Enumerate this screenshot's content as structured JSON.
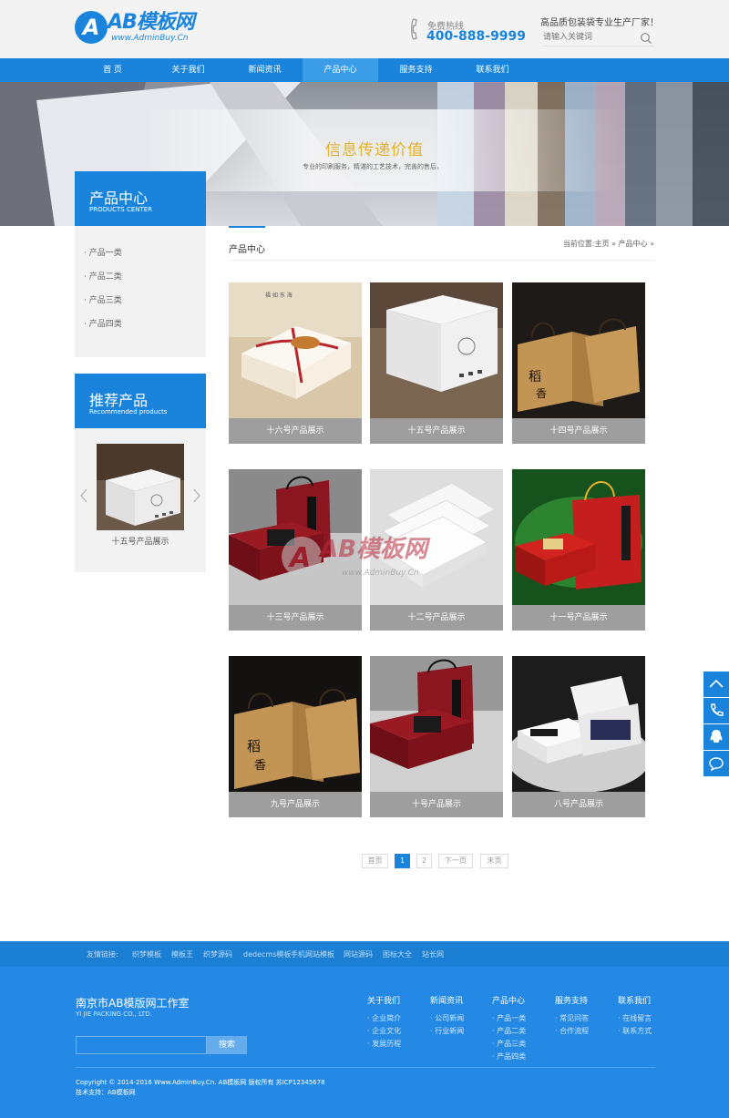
{
  "header": {
    "logo": {
      "mark": "A",
      "name": "AB模板网",
      "url": "www.AdminBuy.Cn"
    },
    "hotline_label": "免费热线",
    "hotline_number": "400-888-9999",
    "slogan": "高品质包装袋专业生产厂家！",
    "search_placeholder": "请输入关键词"
  },
  "nav": [
    "首 页",
    "关于我们",
    "新闻资讯",
    "产品中心",
    "服务支持",
    "联系我们"
  ],
  "nav_active": "产品中心",
  "banner": {
    "title": "信息传递价值",
    "subtitle": "专业的印刷服务，精湛的工艺技术，完善的售后，"
  },
  "sidebar": {
    "category_title": "产品中心",
    "category_title_en": "PRODUCTS CENTER",
    "categories": [
      "产品一类",
      "产品二类",
      "产品三类",
      "产品四类"
    ],
    "recommend_title": "推荐产品",
    "recommend_title_en": "Recommended products",
    "recommend_caption": "十五号产品展示"
  },
  "content": {
    "section_title": "产品中心",
    "breadcrumb": "当前位置:主页 » 产品中心 »",
    "products": [
      "十六号产品展示",
      "十五号产品展示",
      "十四号产品展示",
      "十三号产品展示",
      "十二号产品展示",
      "十一号产品展示",
      "九号产品展示",
      "十号产品展示",
      "八号产品展示"
    ],
    "watermark": {
      "name": "AB模板网",
      "url": "www.AdminBuy.Cn"
    }
  },
  "pager": [
    "首页",
    "1",
    "2",
    "下一页",
    "末页"
  ],
  "pager_current": "1",
  "footer": {
    "links_label": "友情链接:",
    "links": [
      "织梦模板",
      "模板王",
      "织梦源码",
      "dedecms模板",
      "手机网站模板",
      "网站源码",
      "图标大全",
      "站长网"
    ],
    "company": "南京市AB模版网工作室",
    "company_en": "YI JIE PACKING CO., LTD.",
    "search_button": "搜索",
    "columns": [
      {
        "title": "关于我们",
        "items": [
          "企业简介",
          "企业文化",
          "发展历程"
        ]
      },
      {
        "title": "新闻资讯",
        "items": [
          "公司新闻",
          "行业新闻"
        ]
      },
      {
        "title": "产品中心",
        "items": [
          "产品一类",
          "产品二类",
          "产品三类",
          "产品四类"
        ]
      },
      {
        "title": "服务支持",
        "items": [
          "常见问答",
          "合作流程"
        ]
      },
      {
        "title": "联系我们",
        "items": [
          "在线留言",
          "联系方式"
        ]
      }
    ],
    "copyright": "Copyright © 2014-2016 Www.AdminBuy.Cn. AB模板网 版权所有 苏ICP12345678",
    "tech_support": "技术支持：AB模板网"
  },
  "colors": {
    "brand": "#1a84dd",
    "accent_gold": "#e5b22b",
    "caption_gray": "#9e9e9e"
  }
}
